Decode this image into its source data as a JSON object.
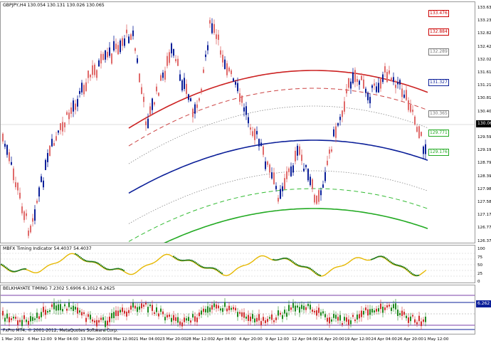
{
  "main": {
    "header": "GBPJPY,H4  130.054 130.131 130.026 130.065",
    "scale_ticks": [
      "133.630",
      "133.230",
      "132.820",
      "132.420",
      "132.020",
      "131.610",
      "131.210",
      "130.810",
      "130.400",
      "130.000",
      "129.590",
      "129.190",
      "128.790",
      "128.390",
      "127.980",
      "127.580",
      "127.170",
      "126.770",
      "126.370"
    ],
    "current_price": "130.065",
    "channel_tags": [
      {
        "text": "133.476",
        "color": "#cc0000"
      },
      {
        "text": "132.884",
        "color": "#cc0000"
      },
      {
        "text": "132.289",
        "color": "#777777"
      },
      {
        "text": "131.327",
        "color": "#0b1f99"
      },
      {
        "text": "130.365",
        "color": "#777777"
      },
      {
        "text": "129.771",
        "color": "#22aa22"
      },
      {
        "text": "129.176",
        "color": "#22aa22"
      }
    ]
  },
  "ind1": {
    "label": "MBFX Timing Indicator 54.4037 54.4037",
    "scale_ticks": [
      "100",
      "75",
      "50",
      "25",
      "0"
    ]
  },
  "ind2": {
    "label": "BELKHAYATE TIMING   7.2302 5.6906 6.1012 6.2625",
    "tag": "6.262"
  },
  "xaxis": [
    "1 Mar 2012",
    "6 Mar 12:00",
    "9 Mar 04:00",
    "13 Mar 20:00",
    "16 Mar 12:00",
    "21 Mar 04:00",
    "23 Mar 20:00",
    "28 Mar 12:00",
    "2 Apr 04:00",
    "4 Apr 20:00",
    "9 Apr 12:00",
    "12 Apr 04:00",
    "16 Apr 20:00",
    "19 Apr 12:00",
    "24 Apr 04:00",
    "26 Apr 20:00",
    "1 May 12:00"
  ],
  "copyright": "FxPro MT4, © 2001-2012, MetaQuotes Software Corp."
}
